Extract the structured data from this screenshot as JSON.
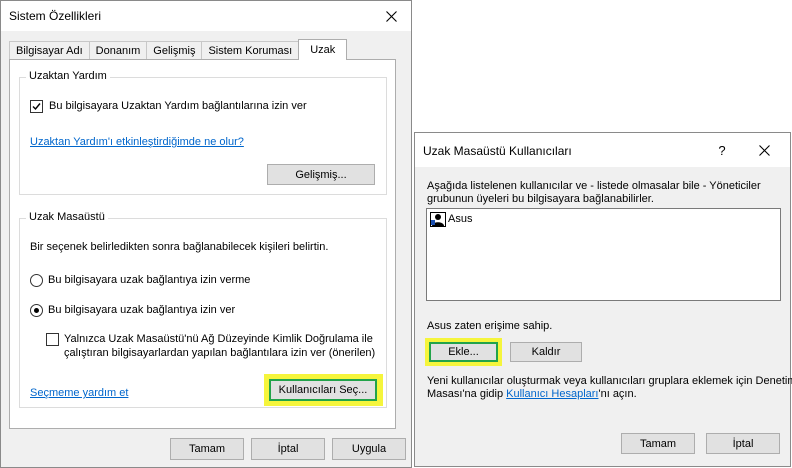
{
  "sysprops": {
    "title": "Sistem Özellikleri",
    "tabs": [
      "Bilgisayar Adı",
      "Donanım",
      "Gelişmiş",
      "Sistem Koruması",
      "Uzak"
    ],
    "active_tab": "Uzak",
    "remote_assistance": {
      "legend": "Uzaktan Yardım",
      "allow_checkbox_label": "Bu bilgisayara Uzaktan Yardım bağlantılarına izin ver",
      "allow_checked": true,
      "help_link": "Uzaktan Yardım'ı etkinleştirdiğimde ne olur?",
      "advanced_button": "Gelişmiş..."
    },
    "remote_desktop": {
      "legend": "Uzak Masaüstü",
      "description": "Bir seçenek belirledikten sonra bağlanabilecek kişileri belirtin.",
      "option_deny": "Bu bilgisayara uzak bağlantıya izin verme",
      "option_allow": "Bu bilgisayara uzak bağlantıya izin ver",
      "selected_option": "allow",
      "nla_line1": "Yalnızca Uzak Masaüstü'nü Ağ Düzeyinde Kimlik Doğrulama ile",
      "nla_line2": "çalıştıran bilgisayarlardan yapılan bağlantılara izin ver (önerilen)",
      "nla_checked": false,
      "help_link": "Seçmeme yardım et",
      "select_users_button": "Kullanıcıları Seç..."
    },
    "footer": {
      "ok": "Tamam",
      "cancel": "İptal",
      "apply": "Uygula"
    }
  },
  "rdusers": {
    "title": "Uzak Masaüstü Kullanıcıları",
    "help_glyph": "?",
    "description_line1": "Aşağıda listelenen kullanıcılar ve - listede olmasalar bile - Yöneticiler",
    "description_line2": "grubunun üyeleri bu bilgisayara bağlanabilirler.",
    "users": [
      "Asus"
    ],
    "access_text": "Asus zaten erişime sahip.",
    "add_button": "Ekle...",
    "remove_button": "Kaldır",
    "info_line1": "Yeni kullanıcılar oluşturmak veya kullanıcıları gruplara eklemek için Denetim",
    "info_line2_pre": "Masası'na gidip ",
    "info_link": "Kullanıcı Hesapları",
    "info_line2_post": "'nı açın.",
    "ok": "Tamam",
    "cancel": "İptal"
  },
  "colors": {
    "highlight": "#f5f53c",
    "focus_border": "#0078d7",
    "highlight_border": "#22a34a",
    "link": "#0066cc"
  }
}
